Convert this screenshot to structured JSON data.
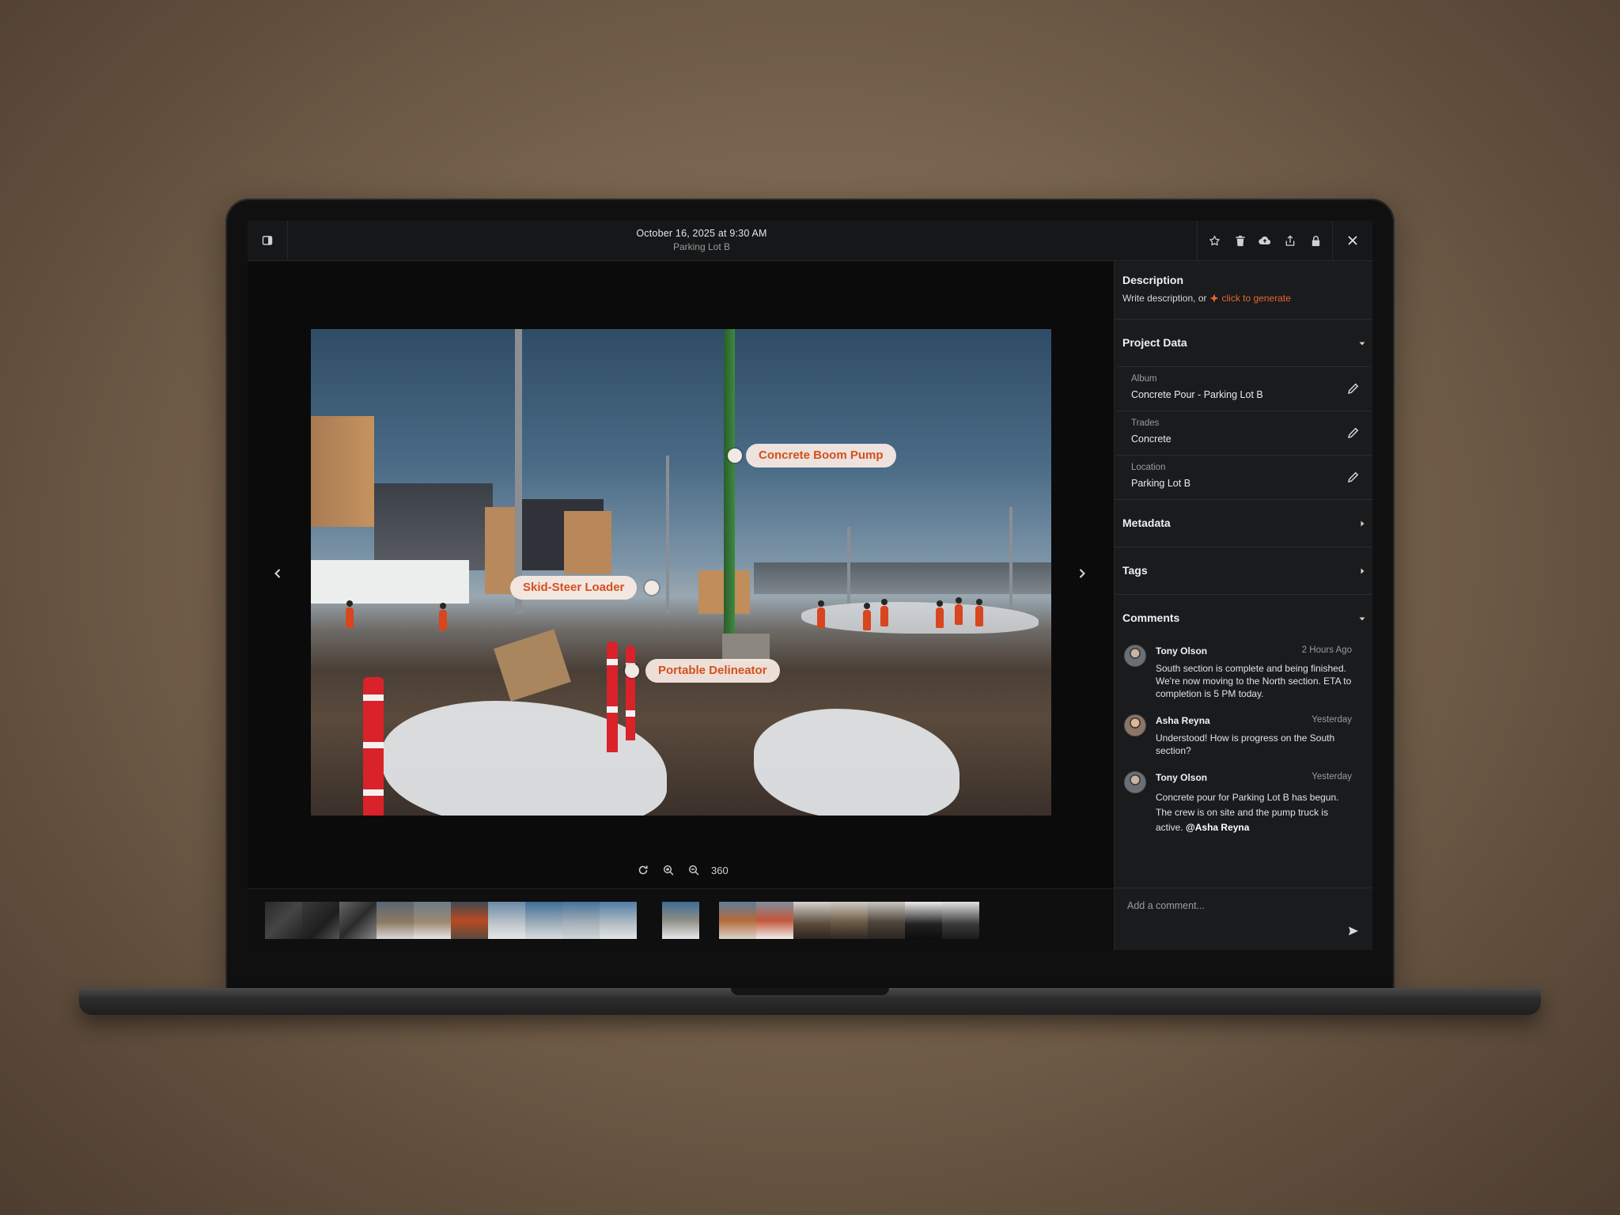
{
  "header": {
    "date": "October 16, 2025 at 9:30 AM",
    "location": "Parking Lot B",
    "panel_toggle_icon": "sidebar-panel-icon",
    "toolbar_icons": [
      "star-icon",
      "trash-icon",
      "cloud-upload-icon",
      "share-icon",
      "lock-icon"
    ],
    "close_icon": "close-icon"
  },
  "photo": {
    "tags": [
      {
        "label": "Concrete Boom Pump"
      },
      {
        "label": "Skid-Steer Loader"
      },
      {
        "label": "Portable Delineator"
      }
    ],
    "tag_color": "#d4501d"
  },
  "viewer": {
    "zoom_label": "360",
    "controls": [
      "rotate-icon",
      "zoom-in-icon",
      "zoom-out-icon"
    ]
  },
  "sidebar": {
    "description": {
      "title": "Description",
      "prompt": "Write description, or",
      "generate_link": "click to generate",
      "accent": "#e3682e"
    },
    "project_data": {
      "title": "Project Data",
      "fields": [
        {
          "label": "Album",
          "value": "Concrete Pour - Parking Lot B"
        },
        {
          "label": "Trades",
          "value": "Concrete"
        },
        {
          "label": "Location",
          "value": "Parking Lot B"
        }
      ]
    },
    "metadata": {
      "title": "Metadata"
    },
    "tags": {
      "title": "Tags"
    },
    "comments": {
      "title": "Comments",
      "items": [
        {
          "author": "Tony Olson",
          "time": "2 Hours Ago",
          "text": "South section is complete and being finished. We're now moving to the North section. ETA to completion is 5 PM today.",
          "mention": ""
        },
        {
          "author": "Asha Reyna",
          "time": "Yesterday",
          "text": "Understood! How is progress on the South section?",
          "mention": ""
        },
        {
          "author": "Tony Olson",
          "time": "Yesterday",
          "text": "Concrete pour for Parking Lot B has begun. The crew is on site and the pump truck is active.",
          "mention": "@Asha Reyna"
        }
      ],
      "input_placeholder": "Add a comment..."
    }
  }
}
